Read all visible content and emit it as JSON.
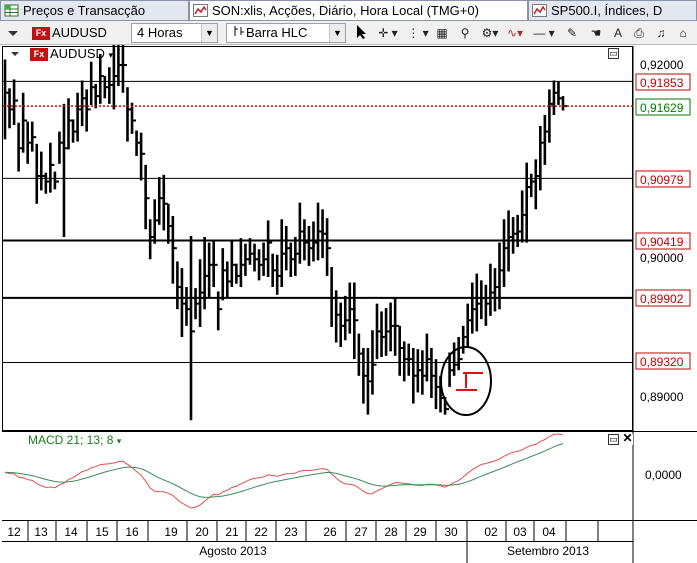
{
  "tabs": [
    {
      "label": "Preços e Transacção",
      "icon": "price-table-icon"
    },
    {
      "label": "SON:xlis, Acções, Diário, Hora Local (TMG+0)",
      "icon": "chart-icon"
    },
    {
      "label": "SP500.I, Índices, D",
      "icon": "chart-icon"
    }
  ],
  "toolbar": {
    "symbol": "AUDUSD",
    "symbol_badge": "Fx",
    "timeframe": "4 Horas",
    "chart_style": "Barra HLC",
    "tools": [
      "cursor-icon",
      "crosshair-icon",
      "grid-icon",
      "zoom-icon",
      "indicator-icon",
      "line-tool-icon",
      "pencil-icon",
      "print-icon",
      "help-icon"
    ]
  },
  "main_chart": {
    "symbol": "AUDUSD",
    "symbol_badge": "Fx",
    "current_price": "0,91629",
    "price_labels": [
      "0,92000",
      "0,90000",
      "0,89000"
    ],
    "level_labels": [
      "0,91853",
      "0,90979",
      "0,90419",
      "0,89902",
      "0,89320"
    ],
    "colors": {
      "level_label": "#c00000",
      "current_label": "#007a00",
      "current_line": "#d00000",
      "annotation_circle": "#000000"
    }
  },
  "macd": {
    "label": "MACD 21; 13; 8",
    "zero_label": "0,0000",
    "colors": {
      "macd_line": "#e05050",
      "signal_line": "#3c8a5a"
    }
  },
  "time_axis": {
    "days": [
      "12",
      "13",
      "14",
      "15",
      "16",
      "19",
      "20",
      "21",
      "22",
      "23",
      "26",
      "27",
      "28",
      "29",
      "30",
      "02",
      "03",
      "04"
    ],
    "months": [
      "Agosto 2013",
      "Setembro 2013"
    ]
  },
  "chart_data": {
    "type": "ohlc",
    "instrument": "AUDUSD",
    "timeframe": "4 Horas",
    "ylim": [
      0.885,
      0.9235
    ],
    "resistance_support_levels": [
      0.91853,
      0.90979,
      0.90419,
      0.89902,
      0.8932
    ],
    "last_price": 0.91629,
    "bars": [
      {
        "h": 0.9205,
        "l": 0.9133,
        "c": 0.9175
      },
      {
        "h": 0.9179,
        "l": 0.9143,
        "c": 0.916
      },
      {
        "h": 0.9187,
        "l": 0.9146,
        "c": 0.9168
      },
      {
        "h": 0.9148,
        "l": 0.9104,
        "c": 0.9125
      },
      {
        "h": 0.9175,
        "l": 0.9121,
        "c": 0.915
      },
      {
        "h": 0.9149,
        "l": 0.9111,
        "c": 0.913
      },
      {
        "h": 0.9149,
        "l": 0.9122,
        "c": 0.9135
      },
      {
        "h": 0.9129,
        "l": 0.9075,
        "c": 0.91
      },
      {
        "h": 0.9122,
        "l": 0.9087,
        "c": 0.91
      },
      {
        "h": 0.9103,
        "l": 0.9084,
        "c": 0.9095
      },
      {
        "h": 0.913,
        "l": 0.9085,
        "c": 0.911
      },
      {
        "h": 0.9104,
        "l": 0.9088,
        "c": 0.9095
      },
      {
        "h": 0.914,
        "l": 0.9111,
        "c": 0.913
      },
      {
        "h": 0.9165,
        "l": 0.9045,
        "c": 0.9125
      },
      {
        "h": 0.917,
        "l": 0.9124,
        "c": 0.915
      },
      {
        "h": 0.9151,
        "l": 0.913,
        "c": 0.914
      },
      {
        "h": 0.9175,
        "l": 0.9131,
        "c": 0.916
      },
      {
        "h": 0.9186,
        "l": 0.9145,
        "c": 0.917
      },
      {
        "h": 0.9178,
        "l": 0.914,
        "c": 0.916
      },
      {
        "h": 0.9203,
        "l": 0.9164,
        "c": 0.918
      },
      {
        "h": 0.9183,
        "l": 0.9161,
        "c": 0.9172
      },
      {
        "h": 0.921,
        "l": 0.9165,
        "c": 0.919
      },
      {
        "h": 0.919,
        "l": 0.917,
        "c": 0.918
      },
      {
        "h": 0.9198,
        "l": 0.9165,
        "c": 0.9182
      },
      {
        "h": 0.9225,
        "l": 0.916,
        "c": 0.919
      },
      {
        "h": 0.9219,
        "l": 0.9181,
        "c": 0.92
      },
      {
        "h": 0.9221,
        "l": 0.9175,
        "c": 0.92
      },
      {
        "h": 0.918,
        "l": 0.9131,
        "c": 0.916
      },
      {
        "h": 0.9166,
        "l": 0.9138,
        "c": 0.915
      },
      {
        "h": 0.9141,
        "l": 0.9118,
        "c": 0.913
      },
      {
        "h": 0.9139,
        "l": 0.9096,
        "c": 0.912
      },
      {
        "h": 0.911,
        "l": 0.9052,
        "c": 0.908
      },
      {
        "h": 0.9061,
        "l": 0.9025,
        "c": 0.9045
      },
      {
        "h": 0.9079,
        "l": 0.9039,
        "c": 0.906
      },
      {
        "h": 0.9099,
        "l": 0.9056,
        "c": 0.908
      },
      {
        "h": 0.9101,
        "l": 0.9051,
        "c": 0.9075
      },
      {
        "h": 0.9075,
        "l": 0.9039,
        "c": 0.9055
      },
      {
        "h": 0.9064,
        "l": 0.9003,
        "c": 0.9035
      },
      {
        "h": 0.9023,
        "l": 0.898,
        "c": 0.9
      },
      {
        "h": 0.9017,
        "l": 0.8955,
        "c": 0.8985
      },
      {
        "h": 0.9,
        "l": 0.8965,
        "c": 0.898
      },
      {
        "h": 0.9046,
        "l": 0.888,
        "c": 0.896
      },
      {
        "h": 0.8999,
        "l": 0.8971,
        "c": 0.8985
      },
      {
        "h": 0.9025,
        "l": 0.8964,
        "c": 0.8995
      },
      {
        "h": 0.9045,
        "l": 0.898,
        "c": 0.901
      },
      {
        "h": 0.904,
        "l": 0.899,
        "c": 0.902
      },
      {
        "h": 0.9041,
        "l": 0.9,
        "c": 0.902
      },
      {
        "h": 0.8996,
        "l": 0.8961,
        "c": 0.898
      },
      {
        "h": 0.9035,
        "l": 0.8988,
        "c": 0.9015
      },
      {
        "h": 0.9023,
        "l": 0.899,
        "c": 0.9005
      },
      {
        "h": 0.9041,
        "l": 0.9,
        "c": 0.902
      },
      {
        "h": 0.9021,
        "l": 0.9003,
        "c": 0.901
      },
      {
        "h": 0.9044,
        "l": 0.9,
        "c": 0.902
      },
      {
        "h": 0.9039,
        "l": 0.901,
        "c": 0.9025
      },
      {
        "h": 0.9044,
        "l": 0.902,
        "c": 0.903
      },
      {
        "h": 0.9039,
        "l": 0.9014,
        "c": 0.9025
      },
      {
        "h": 0.9034,
        "l": 0.9006,
        "c": 0.902
      },
      {
        "h": 0.904,
        "l": 0.901,
        "c": 0.9025
      },
      {
        "h": 0.906,
        "l": 0.9009,
        "c": 0.904
      },
      {
        "h": 0.903,
        "l": 0.9,
        "c": 0.9015
      },
      {
        "h": 0.9029,
        "l": 0.8993,
        "c": 0.901
      },
      {
        "h": 0.9061,
        "l": 0.9,
        "c": 0.903
      },
      {
        "h": 0.9055,
        "l": 0.9015,
        "c": 0.9035
      },
      {
        "h": 0.904,
        "l": 0.9009,
        "c": 0.9025
      },
      {
        "h": 0.9045,
        "l": 0.901,
        "c": 0.903
      },
      {
        "h": 0.9076,
        "l": 0.9021,
        "c": 0.905
      },
      {
        "h": 0.9061,
        "l": 0.9024,
        "c": 0.904
      },
      {
        "h": 0.9055,
        "l": 0.9019,
        "c": 0.9035
      },
      {
        "h": 0.9059,
        "l": 0.9023,
        "c": 0.904
      },
      {
        "h": 0.9076,
        "l": 0.9024,
        "c": 0.905
      },
      {
        "h": 0.907,
        "l": 0.9026,
        "c": 0.9048
      },
      {
        "h": 0.9062,
        "l": 0.901,
        "c": 0.9035
      },
      {
        "h": 0.9018,
        "l": 0.8964,
        "c": 0.899
      },
      {
        "h": 0.8997,
        "l": 0.895,
        "c": 0.8975
      },
      {
        "h": 0.8986,
        "l": 0.8946,
        "c": 0.8965
      },
      {
        "h": 0.8992,
        "l": 0.8952,
        "c": 0.897
      },
      {
        "h": 0.9004,
        "l": 0.8958,
        "c": 0.898
      },
      {
        "h": 0.9004,
        "l": 0.8935,
        "c": 0.897
      },
      {
        "h": 0.8958,
        "l": 0.892,
        "c": 0.894
      },
      {
        "h": 0.8945,
        "l": 0.8895,
        "c": 0.892
      },
      {
        "h": 0.8945,
        "l": 0.8885,
        "c": 0.8915
      },
      {
        "h": 0.8961,
        "l": 0.8903,
        "c": 0.893
      },
      {
        "h": 0.8985,
        "l": 0.8935,
        "c": 0.896
      },
      {
        "h": 0.8978,
        "l": 0.8937,
        "c": 0.8955
      },
      {
        "h": 0.8981,
        "l": 0.8938,
        "c": 0.896
      },
      {
        "h": 0.8986,
        "l": 0.8942,
        "c": 0.8965
      },
      {
        "h": 0.899,
        "l": 0.8938,
        "c": 0.8965
      },
      {
        "h": 0.8965,
        "l": 0.892,
        "c": 0.8945
      },
      {
        "h": 0.8951,
        "l": 0.8915,
        "c": 0.8935
      },
      {
        "h": 0.8949,
        "l": 0.892,
        "c": 0.8935
      },
      {
        "h": 0.8945,
        "l": 0.8895,
        "c": 0.892
      },
      {
        "h": 0.8944,
        "l": 0.8905,
        "c": 0.8925
      },
      {
        "h": 0.8943,
        "l": 0.8903,
        "c": 0.892
      },
      {
        "h": 0.8958,
        "l": 0.8915,
        "c": 0.8935
      },
      {
        "h": 0.8945,
        "l": 0.89,
        "c": 0.892
      },
      {
        "h": 0.8935,
        "l": 0.889,
        "c": 0.891
      },
      {
        "h": 0.892,
        "l": 0.8887,
        "c": 0.89
      },
      {
        "h": 0.8901,
        "l": 0.8885,
        "c": 0.889
      },
      {
        "h": 0.8941,
        "l": 0.891,
        "c": 0.8925
      },
      {
        "h": 0.895,
        "l": 0.892,
        "c": 0.893
      },
      {
        "h": 0.8955,
        "l": 0.8925,
        "c": 0.8935
      },
      {
        "h": 0.8965,
        "l": 0.894,
        "c": 0.8955
      },
      {
        "h": 0.8985,
        "l": 0.8945,
        "c": 0.897
      },
      {
        "h": 0.9004,
        "l": 0.8958,
        "c": 0.898
      },
      {
        "h": 0.9012,
        "l": 0.896,
        "c": 0.8985
      },
      {
        "h": 0.9006,
        "l": 0.8971,
        "c": 0.899
      },
      {
        "h": 0.9002,
        "l": 0.8965,
        "c": 0.8985
      },
      {
        "h": 0.9021,
        "l": 0.8974,
        "c": 0.8995
      },
      {
        "h": 0.9017,
        "l": 0.8978,
        "c": 0.9
      },
      {
        "h": 0.904,
        "l": 0.898,
        "c": 0.9015
      },
      {
        "h": 0.9061,
        "l": 0.9,
        "c": 0.9035
      },
      {
        "h": 0.9069,
        "l": 0.9014,
        "c": 0.9045
      },
      {
        "h": 0.9063,
        "l": 0.903,
        "c": 0.9048
      },
      {
        "h": 0.9065,
        "l": 0.9036,
        "c": 0.905
      },
      {
        "h": 0.9087,
        "l": 0.904,
        "c": 0.9065
      },
      {
        "h": 0.9112,
        "l": 0.904,
        "c": 0.909
      },
      {
        "h": 0.9102,
        "l": 0.9081,
        "c": 0.9095
      },
      {
        "h": 0.9115,
        "l": 0.907,
        "c": 0.91
      },
      {
        "h": 0.9145,
        "l": 0.9087,
        "c": 0.913
      },
      {
        "h": 0.9155,
        "l": 0.911,
        "c": 0.914
      },
      {
        "h": 0.9178,
        "l": 0.913,
        "c": 0.9165
      },
      {
        "h": 0.9186,
        "l": 0.9155,
        "c": 0.9175
      },
      {
        "h": 0.9185,
        "l": 0.9164,
        "c": 0.917
      },
      {
        "h": 0.9172,
        "l": 0.9159,
        "c": 0.9163
      }
    ]
  }
}
